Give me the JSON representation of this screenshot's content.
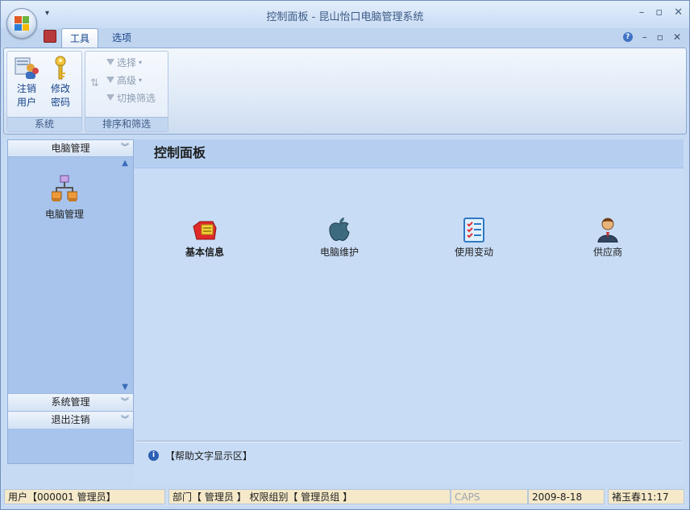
{
  "window": {
    "title": "控制面板 - 昆山怡口电脑管理系统",
    "buttons": [
      "–",
      "▫",
      "✕"
    ]
  },
  "ribbon": {
    "tabs": [
      {
        "label": "工具",
        "active": true
      },
      {
        "label": "选项",
        "active": false
      }
    ],
    "groups": {
      "system": {
        "label": "系统",
        "buttons": [
          {
            "label_line1": "注销",
            "label_line2": "用户",
            "icon": "users-icon"
          },
          {
            "label_line1": "修改",
            "label_line2": "密码",
            "icon": "key-icon"
          }
        ]
      },
      "sort_filter": {
        "label": "排序和筛选",
        "buttons": [
          {
            "label": "选择",
            "dropdown": true,
            "enabled": false
          },
          {
            "label": "高级",
            "dropdown": true,
            "enabled": false
          },
          {
            "label": "切换筛选",
            "dropdown": false,
            "enabled": false
          }
        ]
      }
    }
  },
  "nav": {
    "header": "电脑管理",
    "items": [
      {
        "label": "电脑管理",
        "icon": "network-icon"
      }
    ],
    "sections": [
      "系统管理",
      "退出注销"
    ]
  },
  "content": {
    "title": "控制面板",
    "tiles": [
      {
        "label": "基本信息",
        "icon": "info-folder-icon",
        "bold": true
      },
      {
        "label": "电脑维护",
        "icon": "apple-icon",
        "bold": false
      },
      {
        "label": "使用变动",
        "icon": "checklist-icon",
        "bold": false
      },
      {
        "label": "供应商",
        "icon": "person-icon",
        "bold": false
      }
    ],
    "help_text": "【帮助文字显示区】"
  },
  "status_bar": {
    "user": "用户【000001 管理员】",
    "dept": "部门【 管理员 】 权限组别【 管理员组 】",
    "caps": "CAPS",
    "date": "2009-8-18",
    "time": "褚玉春11:17"
  },
  "colors": {
    "accent": "#15428b",
    "content_bg": "#c8dcf5",
    "nav_bg": "#a8c4ec",
    "status_bg": "#f5e9c9"
  }
}
